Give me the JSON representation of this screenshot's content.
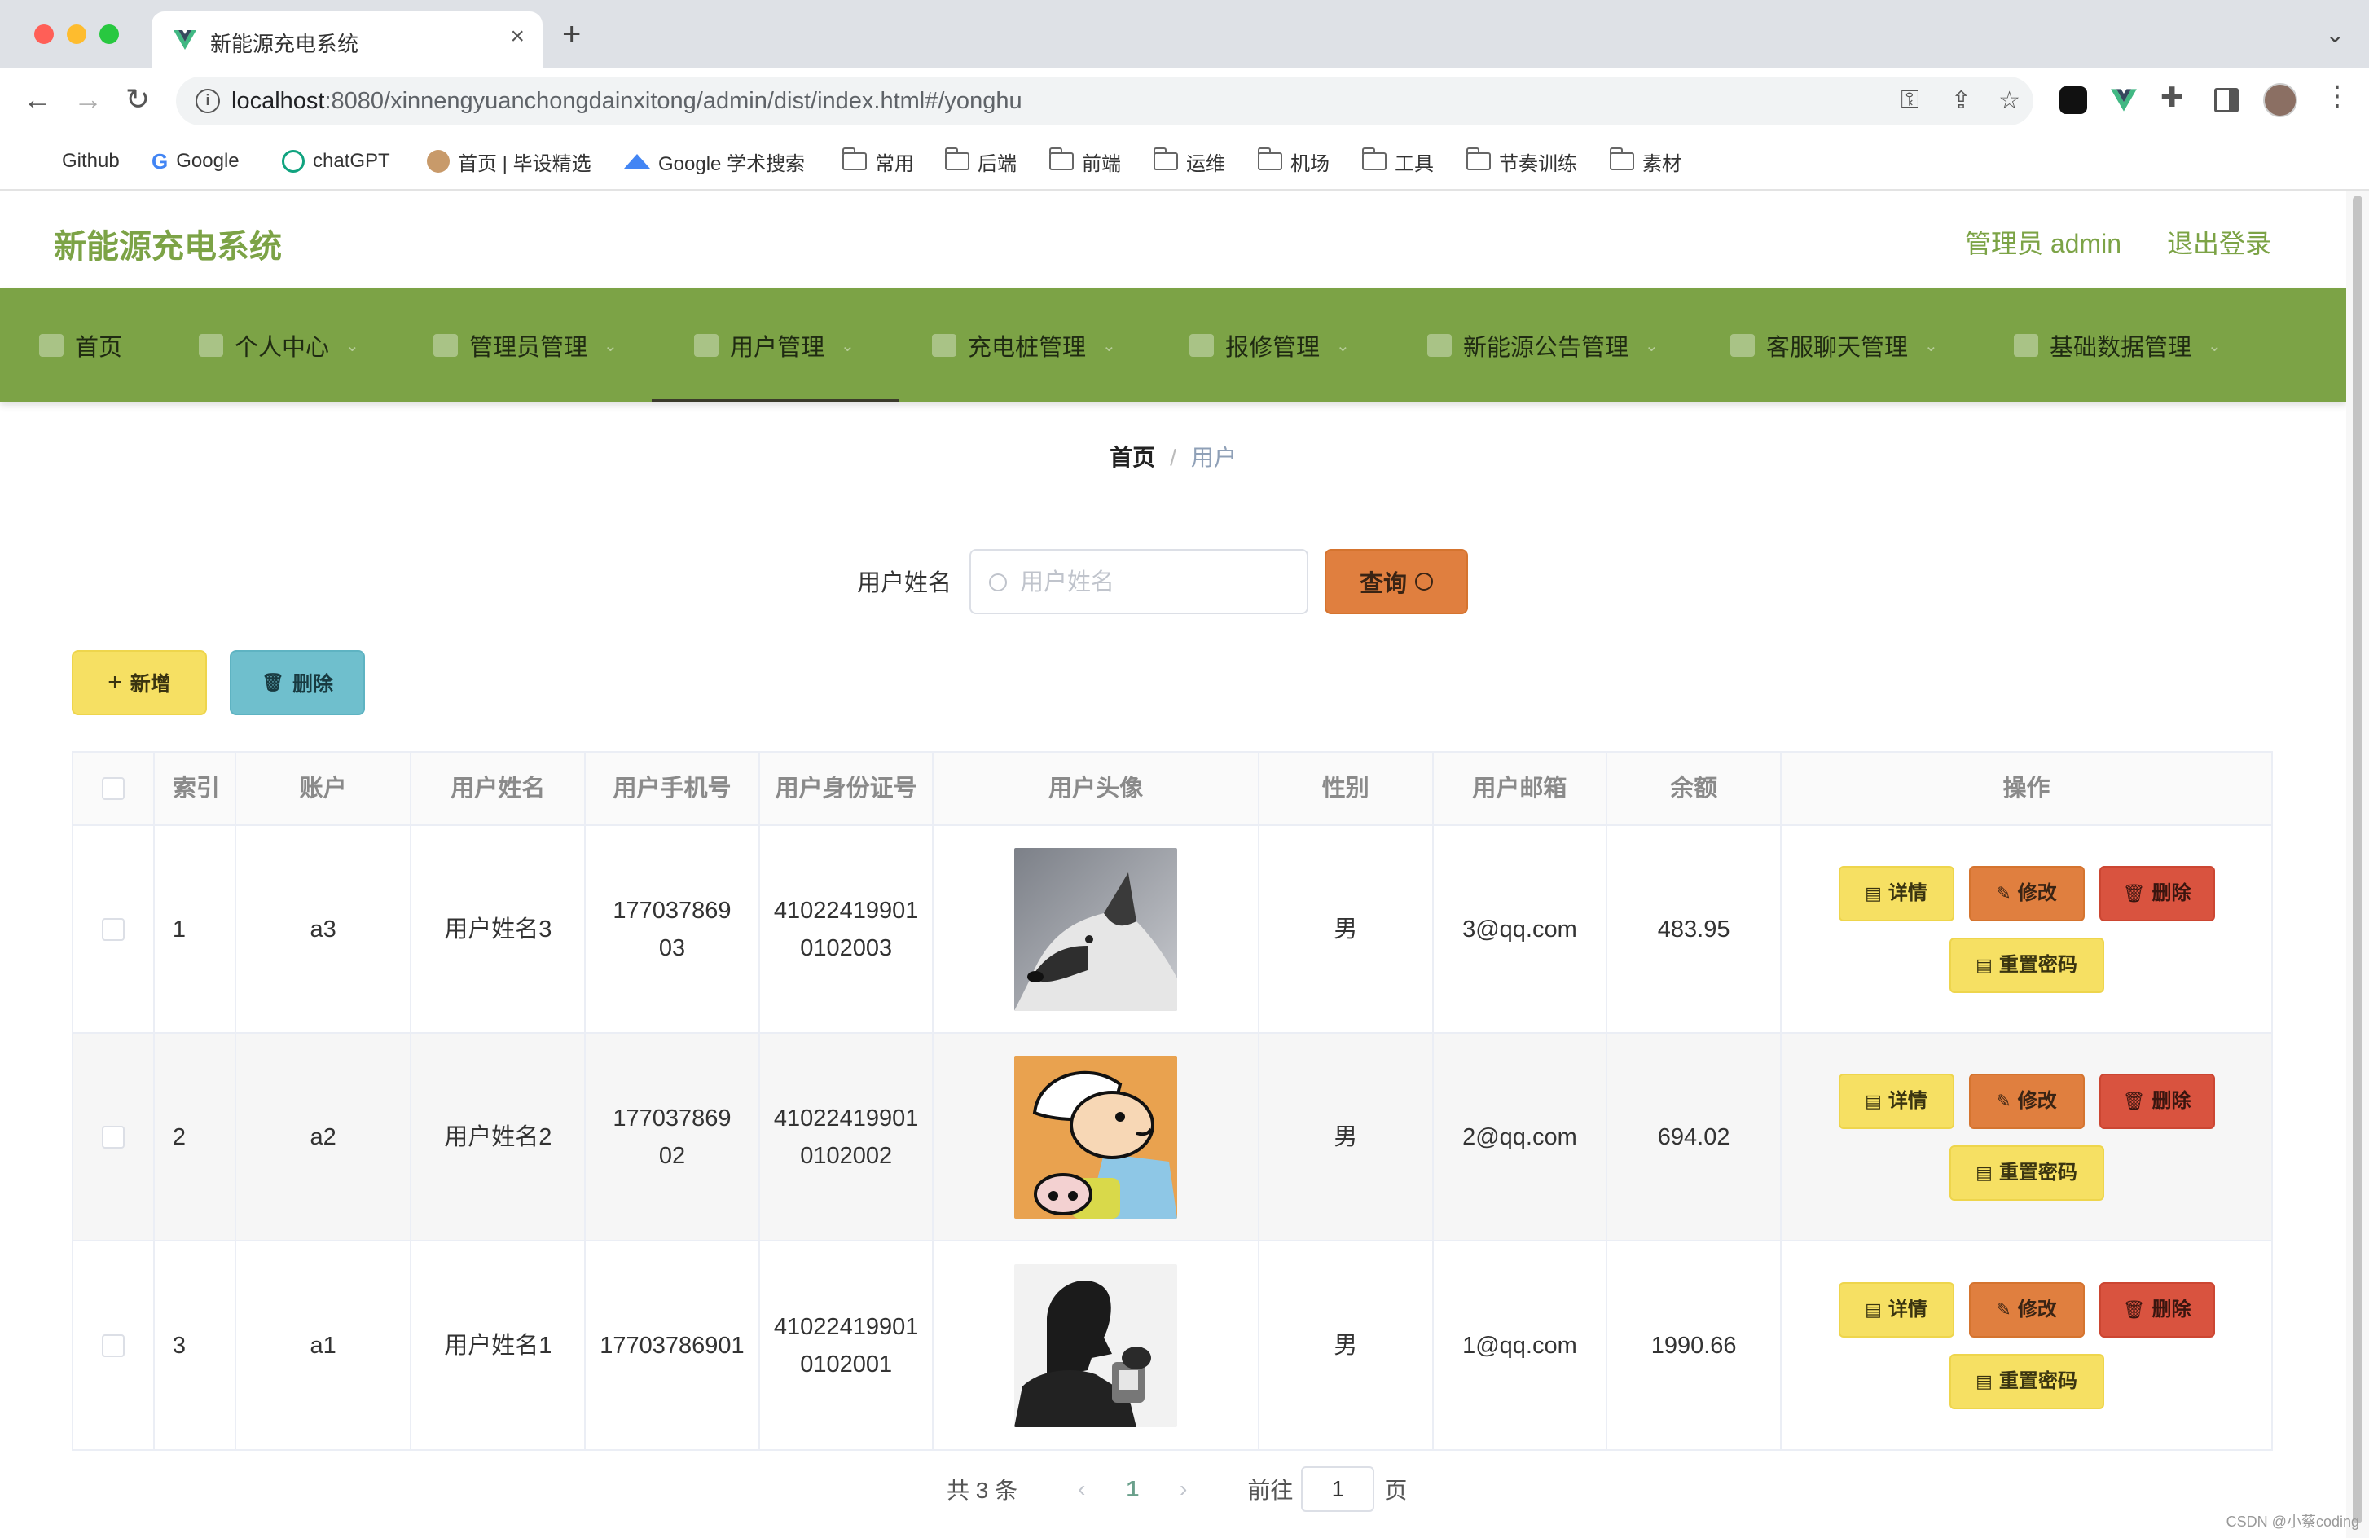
{
  "browser": {
    "tab_title": "新能源充电系统",
    "tab_close": "×",
    "new_tab": "+",
    "url_host": "localhost",
    "url_rest": ":8080/xinnengyuanchongdainxitong/admin/dist/index.html#/yonghu",
    "bookmarks": [
      "Github",
      "Google",
      "chatGPT",
      "首页 | 毕设精选",
      "Google 学术搜索",
      "常用",
      "后端",
      "前端",
      "运维",
      "机场",
      "工具",
      "节奏训练",
      "素材"
    ]
  },
  "header": {
    "title": "新能源充电系统",
    "user": "管理员 admin",
    "logout": "退出登录"
  },
  "menu": [
    {
      "label": "首页"
    },
    {
      "label": "个人中心"
    },
    {
      "label": "管理员管理"
    },
    {
      "label": "用户管理"
    },
    {
      "label": "充电桩管理"
    },
    {
      "label": "报修管理"
    },
    {
      "label": "新能源公告管理"
    },
    {
      "label": "客服聊天管理"
    },
    {
      "label": "基础数据管理"
    }
  ],
  "breadcrumb": {
    "home": "首页",
    "sep": "/",
    "current": "用户"
  },
  "search": {
    "label": "用户姓名",
    "placeholder": "用户姓名",
    "button": "查询"
  },
  "actions": {
    "add": "新增",
    "delete": "删除"
  },
  "table": {
    "headers": [
      "索引",
      "账户",
      "用户姓名",
      "用户手机号",
      "用户身份证号",
      "用户头像",
      "性别",
      "用户邮箱",
      "余额",
      "操作"
    ],
    "rows": [
      {
        "index": "1",
        "account": "a3",
        "name": "用户姓名3",
        "phone": "17703786903",
        "id_card": "410224199010102003",
        "avatar": "husky-dog-photo",
        "gender": "男",
        "email": "3@qq.com",
        "balance": "483.95"
      },
      {
        "index": "2",
        "account": "a2",
        "name": "用户姓名2",
        "phone": "17703786902",
        "id_card": "410224199010102002",
        "avatar": "cartoon-boy-illustration",
        "gender": "男",
        "email": "2@qq.com",
        "balance": "694.02"
      },
      {
        "index": "3",
        "account": "a1",
        "name": "用户姓名1",
        "phone": "17703786901",
        "id_card": "410224199010102001",
        "avatar": "man-silhouette-photo",
        "gender": "男",
        "email": "1@qq.com",
        "balance": "1990.66"
      }
    ],
    "ops": {
      "detail": "详情",
      "edit": "修改",
      "delete": "删除",
      "reset": "重置密码"
    }
  },
  "pagination": {
    "total": "共 3 条",
    "current": "1",
    "goto": "前往",
    "page_input": "1",
    "page_suffix": "页"
  },
  "watermark": "CSDN @小蔡coding",
  "colors": {
    "brand": "#7ca346",
    "query": "#e07f3f",
    "add": "#f6e063",
    "delete_top": "#6fbfcd",
    "delete_row": "#d9533f"
  }
}
